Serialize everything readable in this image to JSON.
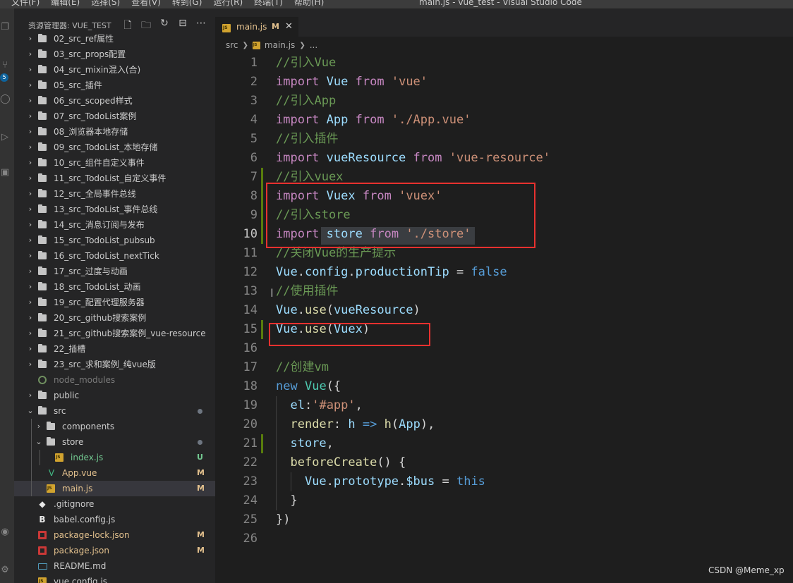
{
  "window": {
    "menus": [
      "文件(F)",
      "编辑(E)",
      "选择(S)",
      "查看(V)",
      "转到(G)",
      "运行(R)",
      "终端(T)",
      "帮助(H)"
    ],
    "title": "main.js - vue_test - Visual Studio Code"
  },
  "activity": {
    "scm_badge": "5"
  },
  "explorer": {
    "title": "资源管理器: VUE_TEST",
    "actions": [
      "new-file",
      "new-folder",
      "refresh",
      "collapse",
      "more"
    ],
    "items": [
      {
        "label": "02_src_ref属性",
        "type": "folder",
        "depth": 0
      },
      {
        "label": "03_src_props配置",
        "type": "folder",
        "depth": 0
      },
      {
        "label": "04_src_mixin混入(合)",
        "type": "folder",
        "depth": 0
      },
      {
        "label": "05_src_插件",
        "type": "folder",
        "depth": 0
      },
      {
        "label": "06_src_scoped样式",
        "type": "folder",
        "depth": 0
      },
      {
        "label": "07_src_TodoList案例",
        "type": "folder",
        "depth": 0
      },
      {
        "label": "08_浏览器本地存储",
        "type": "folder",
        "depth": 0
      },
      {
        "label": "09_src_TodoList_本地存储",
        "type": "folder",
        "depth": 0
      },
      {
        "label": "10_src_组件自定义事件",
        "type": "folder",
        "depth": 0
      },
      {
        "label": "11_src_TodoList_自定义事件",
        "type": "folder",
        "depth": 0
      },
      {
        "label": "12_src_全局事件总线",
        "type": "folder",
        "depth": 0
      },
      {
        "label": "13_src_TodoList_事件总线",
        "type": "folder",
        "depth": 0
      },
      {
        "label": "14_src_消息订阅与发布",
        "type": "folder",
        "depth": 0
      },
      {
        "label": "15_src_TodoList_pubsub",
        "type": "folder",
        "depth": 0
      },
      {
        "label": "16_src_TodoList_nextTick",
        "type": "folder",
        "depth": 0
      },
      {
        "label": "17_src_过度与动画",
        "type": "folder",
        "depth": 0
      },
      {
        "label": "18_src_TodoList_动画",
        "type": "folder",
        "depth": 0
      },
      {
        "label": "19_src_配置代理服务器",
        "type": "folder",
        "depth": 0
      },
      {
        "label": "20_src_github搜索案例",
        "type": "folder",
        "depth": 0
      },
      {
        "label": "21_src_github搜索案例_vue-resource",
        "type": "folder",
        "depth": 0
      },
      {
        "label": "22_插槽",
        "type": "folder",
        "depth": 0
      },
      {
        "label": "23_src_求和案例_纯vue版",
        "type": "folder",
        "depth": 0
      },
      {
        "label": "node_modules",
        "type": "node_modules",
        "depth": 0
      },
      {
        "label": "public",
        "type": "folder",
        "depth": 0
      },
      {
        "label": "src",
        "type": "folder-open",
        "depth": 0,
        "dot": true
      },
      {
        "label": "components",
        "type": "folder",
        "depth": 1
      },
      {
        "label": "store",
        "type": "folder-open",
        "depth": 1,
        "dot": true
      },
      {
        "label": "index.js",
        "type": "js",
        "depth": 2,
        "status": "U"
      },
      {
        "label": "App.vue",
        "type": "vue",
        "depth": 1,
        "status": "M"
      },
      {
        "label": "main.js",
        "type": "js",
        "depth": 1,
        "status": "M",
        "active": true
      },
      {
        "label": ".gitignore",
        "type": "git",
        "depth": 0
      },
      {
        "label": "babel.config.js",
        "type": "babel",
        "depth": 0
      },
      {
        "label": "package-lock.json",
        "type": "json",
        "depth": 0,
        "status": "M"
      },
      {
        "label": "package.json",
        "type": "json",
        "depth": 0,
        "status": "M"
      },
      {
        "label": "README.md",
        "type": "md",
        "depth": 0
      },
      {
        "label": "vue.config.js",
        "type": "js",
        "depth": 0
      }
    ]
  },
  "editor": {
    "tab": {
      "label": "main.js",
      "status": "M"
    },
    "breadcrumb": [
      "src",
      "main.js",
      "..."
    ],
    "current_line": 10,
    "lines": [
      {
        "n": "1",
        "tokens": [
          [
            "cm",
            "//引入Vue"
          ]
        ]
      },
      {
        "n": "2",
        "tokens": [
          [
            "kw",
            "import"
          ],
          [
            "p",
            " "
          ],
          [
            "var",
            "Vue"
          ],
          [
            "p",
            " "
          ],
          [
            "kw",
            "from"
          ],
          [
            "p",
            " "
          ],
          [
            "str",
            "'vue'"
          ]
        ]
      },
      {
        "n": "3",
        "tokens": [
          [
            "cm",
            "//引入App"
          ]
        ]
      },
      {
        "n": "4",
        "tokens": [
          [
            "kw",
            "import"
          ],
          [
            "p",
            " "
          ],
          [
            "var",
            "App"
          ],
          [
            "p",
            " "
          ],
          [
            "kw",
            "from"
          ],
          [
            "p",
            " "
          ],
          [
            "str",
            "'./App.vue'"
          ]
        ]
      },
      {
        "n": "5",
        "tokens": [
          [
            "cm",
            "//引入插件"
          ]
        ]
      },
      {
        "n": "6",
        "tokens": [
          [
            "kw",
            "import"
          ],
          [
            "p",
            " "
          ],
          [
            "var",
            "vueResource"
          ],
          [
            "p",
            " "
          ],
          [
            "kw",
            "from"
          ],
          [
            "p",
            " "
          ],
          [
            "str",
            "'vue-resource'"
          ]
        ]
      },
      {
        "n": "7",
        "tokens": [
          [
            "cm",
            "//引入vuex"
          ]
        ],
        "gutter": "add"
      },
      {
        "n": "8",
        "tokens": [
          [
            "kw",
            "import"
          ],
          [
            "p",
            " "
          ],
          [
            "var",
            "Vuex"
          ],
          [
            "p",
            " "
          ],
          [
            "kw",
            "from"
          ],
          [
            "p",
            " "
          ],
          [
            "str",
            "'vuex'"
          ]
        ],
        "gutter": "add"
      },
      {
        "n": "9",
        "tokens": [
          [
            "cm",
            "//引入store"
          ]
        ],
        "gutter": "add"
      },
      {
        "n": "10",
        "tokens": [
          [
            "kw",
            "import"
          ],
          [
            "p",
            " "
          ],
          [
            "var",
            "store"
          ],
          [
            "p",
            " "
          ],
          [
            "kw",
            "from"
          ],
          [
            "p",
            " "
          ],
          [
            "str",
            "'./store'"
          ]
        ],
        "gutter": "add"
      },
      {
        "n": "11",
        "tokens": [
          [
            "cm",
            "//关闭Vue的生产提示"
          ]
        ]
      },
      {
        "n": "12",
        "tokens": [
          [
            "var",
            "Vue"
          ],
          [
            "p",
            "."
          ],
          [
            "var",
            "config"
          ],
          [
            "p",
            "."
          ],
          [
            "var",
            "productionTip"
          ],
          [
            "p",
            " = "
          ],
          [
            "kb",
            "false"
          ]
        ]
      },
      {
        "n": "13",
        "tokens": [
          [
            "cm",
            "//使用插件"
          ]
        ]
      },
      {
        "n": "14",
        "tokens": [
          [
            "var",
            "Vue"
          ],
          [
            "p",
            "."
          ],
          [
            "fn",
            "use"
          ],
          [
            "p",
            "("
          ],
          [
            "var",
            "vueResource"
          ],
          [
            "p",
            ")"
          ]
        ]
      },
      {
        "n": "15",
        "tokens": [
          [
            "var",
            "Vue"
          ],
          [
            "p",
            "."
          ],
          [
            "fn",
            "use"
          ],
          [
            "p",
            "("
          ],
          [
            "var",
            "Vuex"
          ],
          [
            "p",
            ")"
          ]
        ],
        "gutter": "add"
      },
      {
        "n": "16",
        "tokens": []
      },
      {
        "n": "17",
        "tokens": [
          [
            "cm",
            "//创建vm"
          ]
        ]
      },
      {
        "n": "18",
        "tokens": [
          [
            "kb",
            "new"
          ],
          [
            "p",
            " "
          ],
          [
            "cls",
            "Vue"
          ],
          [
            "p",
            "({"
          ]
        ]
      },
      {
        "n": "19",
        "tokens": [
          [
            "p",
            "  "
          ],
          [
            "var",
            "el"
          ],
          [
            "p",
            ":"
          ],
          [
            "str",
            "'#app'"
          ],
          [
            "p",
            ","
          ]
        ],
        "indent": 1
      },
      {
        "n": "20",
        "tokens": [
          [
            "p",
            "  "
          ],
          [
            "fn",
            "render"
          ],
          [
            "p",
            ": "
          ],
          [
            "var",
            "h"
          ],
          [
            "p",
            " "
          ],
          [
            "kb",
            "=>"
          ],
          [
            "p",
            " "
          ],
          [
            "fn",
            "h"
          ],
          [
            "p",
            "("
          ],
          [
            "var",
            "App"
          ],
          [
            "p",
            "),"
          ]
        ],
        "indent": 1
      },
      {
        "n": "21",
        "tokens": [
          [
            "p",
            "  "
          ],
          [
            "var",
            "store"
          ],
          [
            "p",
            ","
          ]
        ],
        "indent": 1,
        "gutter": "add"
      },
      {
        "n": "22",
        "tokens": [
          [
            "p",
            "  "
          ],
          [
            "fn",
            "beforeCreate"
          ],
          [
            "p",
            "() {"
          ]
        ],
        "indent": 1
      },
      {
        "n": "23",
        "tokens": [
          [
            "p",
            "    "
          ],
          [
            "var",
            "Vue"
          ],
          [
            "p",
            "."
          ],
          [
            "var",
            "prototype"
          ],
          [
            "p",
            "."
          ],
          [
            "var",
            "$bus"
          ],
          [
            "p",
            " = "
          ],
          [
            "kb",
            "this"
          ]
        ],
        "indent": 2
      },
      {
        "n": "24",
        "tokens": [
          [
            "p",
            "  }"
          ]
        ],
        "indent": 1
      },
      {
        "n": "25",
        "tokens": [
          [
            "p",
            "})"
          ]
        ]
      },
      {
        "n": "26",
        "tokens": []
      }
    ]
  },
  "watermark": "CSDN @Meme_xp",
  "colors": {
    "editor_bg": "#1e1e1e",
    "sidebar_bg": "#252526",
    "highlight_box": "#e8312f",
    "comment": "#6a9955",
    "keyword": "#c586c0",
    "string": "#ce9178",
    "variable": "#9cdcfe",
    "modified": "#e2c08d",
    "untracked": "#73c991"
  }
}
